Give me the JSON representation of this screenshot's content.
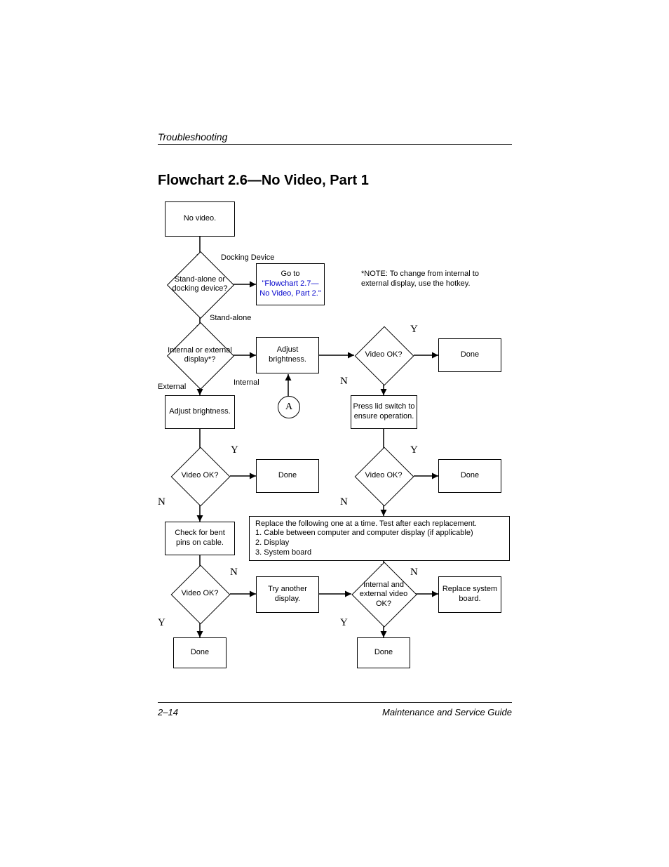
{
  "header": {
    "section": "Troubleshooting"
  },
  "title": "Flowchart 2.6—No Video, Part 1",
  "note": "*NOTE: To change from internal to external display, use the hotkey.",
  "nodes": {
    "no_video": "No video.",
    "stand_alone_q": "Stand-alone or docking device?",
    "goto_prefix": "Go to",
    "goto_link": "\"Flowchart 2.7—No Video, Part 2.\"",
    "int_ext_q": "Internal or external display*?",
    "adjust_brightness": "Adjust brightness.",
    "video_ok": "Video OK?",
    "done": "Done",
    "press_lid": "Press lid switch to ensure operation.",
    "connector_a": "A",
    "check_bent": "Check for bent pins on cable.",
    "replace_list": "Replace the following one at a time. Test after each replacement.\n   1. Cable between computer and computer display (if applicable)\n   2. Display\n   3. System board",
    "try_another": "Try another display.",
    "int_ext_ok_q": "Internal and external video OK?",
    "replace_board": "Replace system board."
  },
  "labels": {
    "docking_device": "Docking Device",
    "stand_alone": "Stand-alone",
    "internal": "Internal",
    "external": "External",
    "Y": "Y",
    "N": "N"
  },
  "footer": {
    "page": "2–14",
    "book": "Maintenance and Service Guide"
  }
}
